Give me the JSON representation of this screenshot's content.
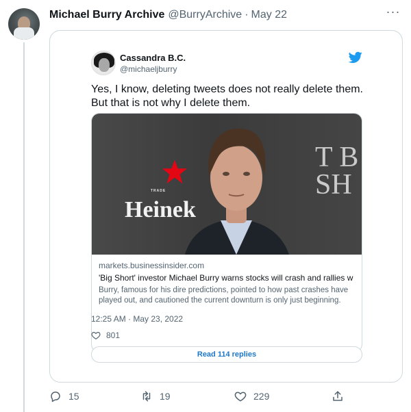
{
  "tweet": {
    "author_name": "Michael Burry Archive",
    "author_handle": "@BurryArchive",
    "separator": "·",
    "date": "May 22",
    "more_label": "···"
  },
  "quoted": {
    "author_name": "Cassandra B.C.",
    "author_handle": "@michaeljburry",
    "text": "Yes, I know, deleting tweets does not really delete them. But that is not why I delete them.",
    "link": {
      "image_trade_text": "TRADE",
      "image_brand_text": "Heinek",
      "image_poster_text": "T B SH",
      "domain": "markets.businessinsider.com",
      "title": "'Big Short' investor Michael Burry warns stocks will crash and rallies won'...",
      "description": "Burry, famous for his dire predictions, pointed to how past crashes have played out, and cautioned the current downturn is only just beginning."
    },
    "timestamp": "12:25 AM · May 23, 2022",
    "likes": "801",
    "read_replies": "Read 114 replies"
  },
  "actions": {
    "reply_count": "15",
    "retweet_count": "19",
    "like_count": "229"
  },
  "icons": {
    "bird": "twitter-bird-icon",
    "heart": "heart-icon",
    "reply": "reply-icon",
    "retweet": "retweet-icon",
    "share": "share-icon",
    "more": "more-icon"
  },
  "colors": {
    "twitter_blue": "#1d9bf0",
    "link_blue": "#1d77c8",
    "muted": "#536471",
    "border": "#cfd9de",
    "star_red": "#e30613"
  }
}
